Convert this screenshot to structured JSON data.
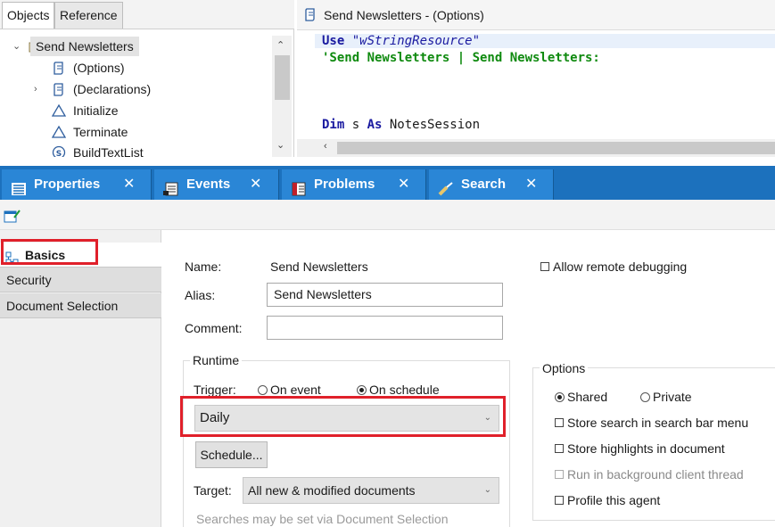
{
  "objects_pane": {
    "tabs": [
      "Objects",
      "Reference"
    ],
    "tree": [
      {
        "label": "Send Newsletters",
        "twisty": "⌄"
      },
      {
        "label": "(Options)",
        "twisty": ""
      },
      {
        "label": "(Declarations)",
        "twisty": "›"
      },
      {
        "label": "Initialize",
        "twisty": ""
      },
      {
        "label": "Terminate",
        "twisty": ""
      },
      {
        "label": "BuildTextList",
        "twisty": ""
      }
    ]
  },
  "code_pane": {
    "title": "Send Newsletters  - (Options)",
    "lines": {
      "l1_kw": "Use",
      "l1_str": "\"wStringResource\"",
      "l2_comment": "'Send Newsletters | Send Newsletters:",
      "l3_kw1": "Dim",
      "l3_text1": " s ",
      "l3_kw2": "As",
      "l3_text2": " NotesSession"
    }
  },
  "tabs": [
    {
      "label": "Properties",
      "icon": "properties-icon"
    },
    {
      "label": "Events",
      "icon": "events-icon"
    },
    {
      "label": "Problems",
      "icon": "problems-icon"
    },
    {
      "label": "Search",
      "icon": "search-icon"
    }
  ],
  "close_glyph": "✕",
  "left_nav": {
    "items": [
      "Basics",
      "Security",
      "Document Selection"
    ]
  },
  "basics": {
    "name_label": "Name:",
    "name_value": "Send Newsletters",
    "alias_label": "Alias:",
    "alias_value": "Send Newsletters",
    "comment_label": "Comment:",
    "comment_value": "",
    "allow_remote_debugging": "Allow remote debugging",
    "runtime_title": "Runtime",
    "trigger_label": "Trigger:",
    "trigger_on_event": "On event",
    "trigger_on_schedule": "On schedule",
    "schedule_value": "Daily",
    "schedule_button": "Schedule...",
    "target_label": "Target:",
    "target_value": "All new & modified documents",
    "hint": "Searches may be set via Document Selection"
  },
  "options": {
    "title": "Options",
    "shared": "Shared",
    "private": "Private",
    "store_search": "Store search in search bar menu",
    "store_highlights": "Store highlights in document",
    "run_background": "Run in background client thread",
    "profile_agent": "Profile this agent"
  },
  "colors": {
    "tab_bar": "#1c71bd",
    "tab": "#2a86d6",
    "highlight_box": "#e0202a",
    "keyword": "#1a1aa0",
    "comment": "#0f8a0f"
  }
}
